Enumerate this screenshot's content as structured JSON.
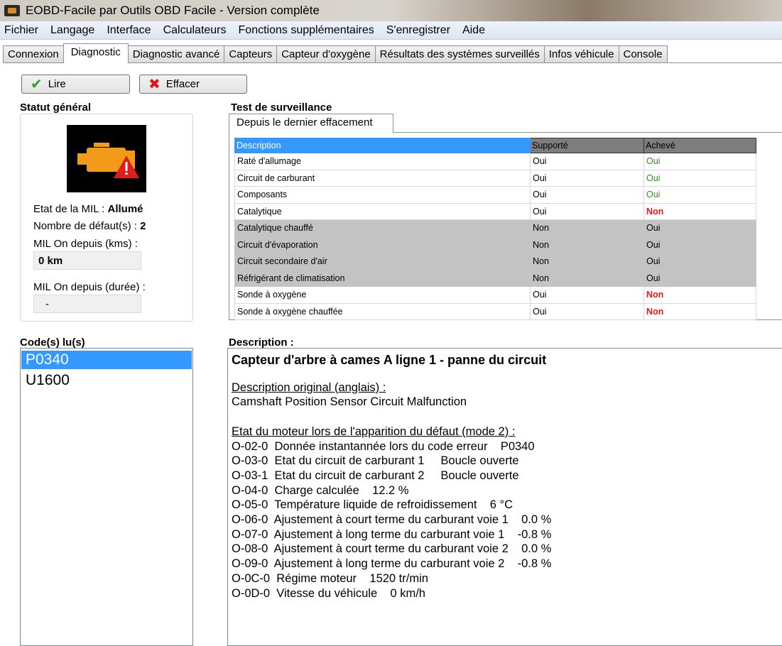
{
  "window": {
    "title": "EOBD-Facile par Outils OBD Facile - Version complète"
  },
  "menu": [
    "Fichier",
    "Langage",
    "Interface",
    "Calculateurs",
    "Fonctions supplémentaires",
    "S'enregistrer",
    "Aide"
  ],
  "tabs": [
    "Connexion",
    "Diagnostic",
    "Diagnostic avancé",
    "Capteurs",
    "Capteur d'oxygène",
    "Résultats des systèmes surveillés",
    "Infos véhicule",
    "Console"
  ],
  "active_tab": "Diagnostic",
  "buttons": {
    "read": "Lire",
    "clear": "Effacer"
  },
  "status": {
    "heading": "Statut général",
    "mil_label": "Etat de la MIL : ",
    "mil_value": "Allumé",
    "faults_label": "Nombre de défaut(s) : ",
    "faults_value": "2",
    "km_label": "MIL On depuis (kms) :",
    "km_value": "0 km",
    "duration_label": "MIL On depuis (durée) :",
    "duration_value": "-"
  },
  "monitor": {
    "heading": "Test de surveillance",
    "subtab": "Depuis le dernier effacement",
    "columns": [
      "Description",
      "Supporté",
      "Achevé"
    ],
    "rows": [
      [
        "Raté d'allumage",
        "Oui",
        "Oui"
      ],
      [
        "Circuit de carburant",
        "Oui",
        "Oui"
      ],
      [
        "Composants",
        "Oui",
        "Oui"
      ],
      [
        "Catalytique",
        "Oui",
        "Non"
      ],
      [
        "Catalytique chauffé",
        "Non",
        "Oui"
      ],
      [
        "Circuit d'évaporation",
        "Non",
        "Oui"
      ],
      [
        "Circuit secondaire d'air",
        "Non",
        "Oui"
      ],
      [
        "Réfrigérant de climatisation",
        "Non",
        "Oui"
      ],
      [
        "Sonde à oxygène",
        "Oui",
        "Non"
      ],
      [
        "Sonde à oxygène chauffée",
        "Oui",
        "Non"
      ]
    ]
  },
  "codes": {
    "heading": "Code(s) lu(s)",
    "items": [
      "P0340",
      "U1600"
    ],
    "selected": "P0340"
  },
  "description": {
    "heading": "Description :",
    "title": "Capteur d'arbre à cames A ligne 1 - panne du circuit",
    "orig_label": "Description original (anglais) :",
    "orig_text": "Camshaft Position Sensor Circuit Malfunction",
    "freeze_label": "Etat du moteur lors de l'apparition du défaut (mode 2) :",
    "freeze": [
      "O-02-0  Donnée instantannée lors du code erreur    P0340",
      "O-03-0  Etat du circuit de carburant 1     Boucle ouverte",
      "O-03-1  Etat du circuit de carburant 2     Boucle ouverte",
      "O-04-0  Charge calculée    12.2 %",
      "O-05-0  Température liquide de refroidissement    6 °C",
      "O-06-0  Ajustement à court terme du carburant voie 1    0.0 %",
      "O-07-0  Ajustement à long terme du carburant voie 1    -0.8 %",
      "O-08-0  Ajustement à court terme du carburant voie 2    0.0 %",
      "O-09-0  Ajustement à long terme du carburant voie 2    -0.8 %",
      "O-0C-0  Régime moteur    1520 tr/min",
      "O-0D-0  Vitesse du véhicule    0 km/h"
    ]
  }
}
